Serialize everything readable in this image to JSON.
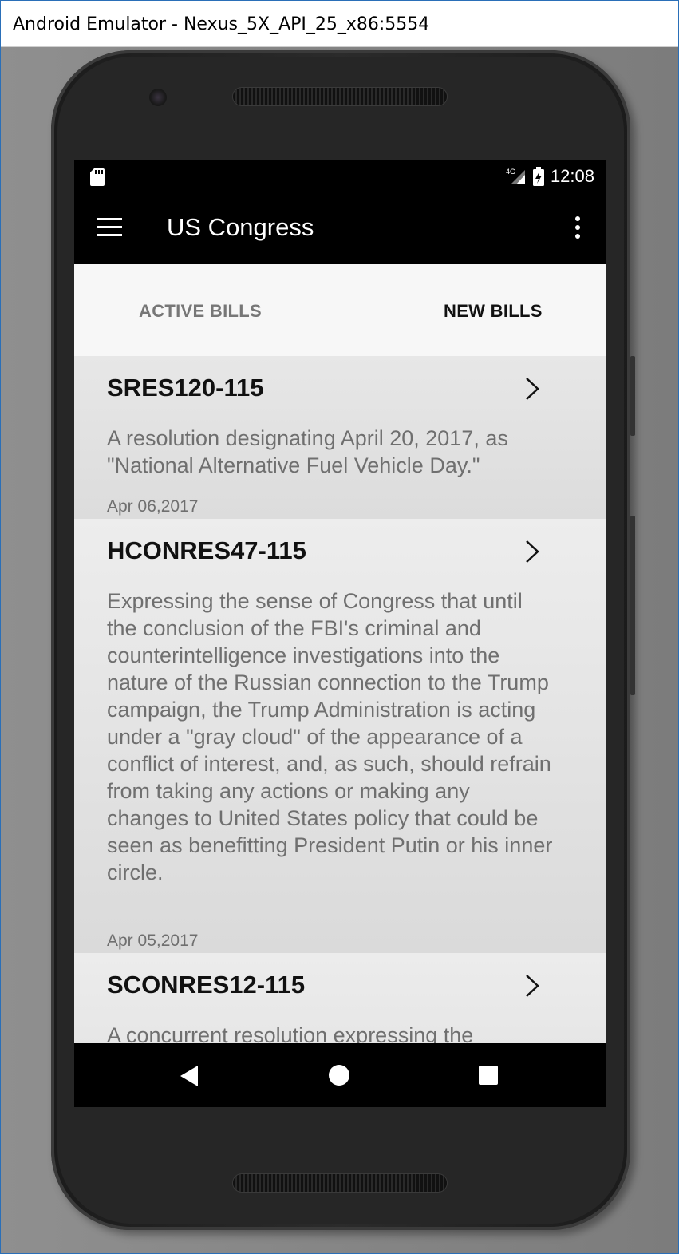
{
  "window": {
    "title": "Android Emulator - Nexus_5X_API_25_x86:5554"
  },
  "statusbar": {
    "network": "4G",
    "time": "12:08"
  },
  "appbar": {
    "title": "US Congress"
  },
  "tabs": [
    {
      "label": "ACTIVE BILLS",
      "selected": false
    },
    {
      "label": "NEW BILLS",
      "selected": true
    }
  ],
  "bills": [
    {
      "id": "SRES120-115",
      "description": "A resolution designating April 20, 2017, as \"National Alternative Fuel Vehicle Day.\"",
      "date": "Apr 06,2017"
    },
    {
      "id": "HCONRES47-115",
      "description": "Expressing the sense of Congress that until the conclusion of the FBI's criminal and counterintelligence investigations into the nature of the Russian connection to the Trump campaign, the Trump Administration is acting under a \"gray cloud\" of the appearance of a conflict of interest, and, as such, should refrain from taking any actions or making any changes to United States policy that could be seen as benefitting President Putin or his inner circle.",
      "date": "Apr 05,2017"
    },
    {
      "id": "SCONRES12-115",
      "description": "A concurrent resolution expressing the",
      "date": ""
    }
  ],
  "icons": {
    "menu": "hamburger-menu-icon",
    "overflow": "more-vert-icon",
    "chevron": "chevron-right-icon",
    "sd": "sd-card-icon",
    "signal": "signal-icon",
    "battery": "battery-charging-icon"
  }
}
